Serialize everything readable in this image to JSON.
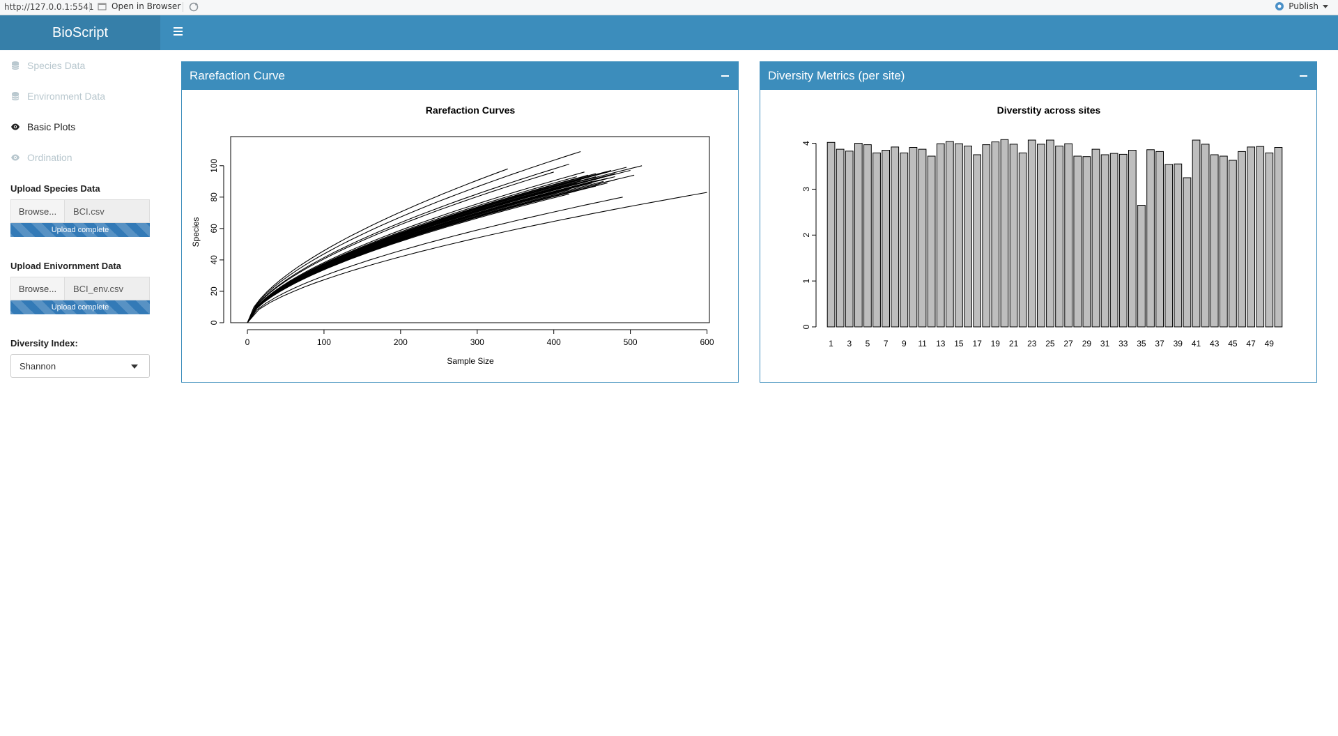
{
  "viewer": {
    "url": "http://127.0.0.1:5541",
    "open_in_browser": "Open in Browser",
    "publish": "Publish"
  },
  "app": {
    "title": "BioScript"
  },
  "sidebar": {
    "menu": [
      {
        "label": "Species Data",
        "icon": "database-icon",
        "active": false
      },
      {
        "label": "Environment Data",
        "icon": "database-icon",
        "active": false
      },
      {
        "label": "Basic Plots",
        "icon": "eye-icon",
        "active": true
      },
      {
        "label": "Ordination",
        "icon": "eye-icon",
        "active": false
      }
    ],
    "upload_species": {
      "label": "Upload Species Data",
      "button": "Browse...",
      "file": "BCI.csv",
      "progress_text": "Upload complete",
      "progress": 1.0
    },
    "upload_env": {
      "label": "Upload Enivornment Data",
      "button": "Browse...",
      "file": "BCI_env.csv",
      "progress_text": "Upload complete",
      "progress": 1.0
    },
    "diversity": {
      "label": "Diversity Index:",
      "selected": "Shannon"
    }
  },
  "boxes": {
    "rarefaction": {
      "title": "Rarefaction Curve",
      "collapse": "−"
    },
    "diversity": {
      "title": "Diversity Metrics (per site)",
      "collapse": "−"
    }
  },
  "chart_data": [
    {
      "type": "line",
      "title": "Rarefaction Curves",
      "xlabel": "Sample Size",
      "ylabel": "Species",
      "xlim": [
        0,
        625
      ],
      "ylim": [
        0,
        115
      ],
      "xticks": [
        0,
        100,
        200,
        300,
        400,
        500,
        600
      ],
      "yticks": [
        0,
        20,
        40,
        60,
        80,
        100
      ],
      "grid": false,
      "series_endpoints": [
        [
          448,
          93
        ],
        [
          435,
          85
        ],
        [
          430,
          84
        ],
        [
          420,
          82
        ],
        [
          460,
          95
        ],
        [
          475,
          94
        ],
        [
          390,
          80
        ],
        [
          430,
          87
        ],
        [
          410,
          88
        ],
        [
          450,
          89
        ],
        [
          460,
          92
        ],
        [
          480,
          91
        ],
        [
          500,
          97
        ],
        [
          440,
          96
        ],
        [
          425,
          90
        ],
        [
          470,
          89
        ],
        [
          455,
          93
        ],
        [
          435,
          91
        ],
        [
          515,
          100
        ],
        [
          505,
          94
        ],
        [
          430,
          92
        ],
        [
          480,
          95
        ],
        [
          415,
          87
        ],
        [
          445,
          86
        ],
        [
          460,
          88
        ],
        [
          435,
          109
        ],
        [
          340,
          98
        ],
        [
          490,
          80
        ],
        [
          600,
          83
        ],
        [
          470,
          96
        ],
        [
          420,
          101
        ],
        [
          400,
          96
        ],
        [
          440,
          90
        ],
        [
          455,
          87
        ],
        [
          470,
          92
        ],
        [
          430,
          89
        ],
        [
          410,
          84
        ],
        [
          460,
          91
        ],
        [
          445,
          94
        ],
        [
          425,
          86
        ],
        [
          480,
          93
        ],
        [
          450,
          90
        ],
        [
          495,
          99
        ],
        [
          435,
          88
        ],
        [
          465,
          90
        ],
        [
          440,
          92
        ],
        [
          420,
          85
        ],
        [
          455,
          95
        ],
        [
          430,
          93
        ],
        [
          475,
          97
        ]
      ]
    },
    {
      "type": "bar",
      "title": "Diverstity across sites",
      "categories": [
        "1",
        "2",
        "3",
        "4",
        "5",
        "6",
        "7",
        "8",
        "9",
        "10",
        "11",
        "12",
        "13",
        "14",
        "15",
        "16",
        "17",
        "18",
        "19",
        "20",
        "21",
        "22",
        "23",
        "24",
        "25",
        "26",
        "27",
        "28",
        "29",
        "30",
        "31",
        "32",
        "33",
        "34",
        "35",
        "36",
        "37",
        "38",
        "39",
        "40",
        "41",
        "42",
        "43",
        "44",
        "45",
        "46",
        "47",
        "48",
        "49",
        "50"
      ],
      "tick_labels_shown": [
        "1",
        "3",
        "5",
        "7",
        "9",
        "11",
        "13",
        "15",
        "17",
        "19",
        "21",
        "23",
        "25",
        "27",
        "29",
        "31",
        "33",
        "35",
        "37",
        "39",
        "41",
        "43",
        "45",
        "47",
        "49"
      ],
      "values": [
        4.02,
        3.87,
        3.83,
        4.0,
        3.97,
        3.79,
        3.85,
        3.92,
        3.79,
        3.91,
        3.87,
        3.72,
        3.99,
        4.04,
        3.99,
        3.94,
        3.75,
        3.97,
        4.03,
        4.08,
        3.98,
        3.79,
        4.07,
        3.98,
        4.07,
        3.94,
        3.99,
        3.72,
        3.71,
        3.87,
        3.75,
        3.78,
        3.76,
        3.85,
        2.65,
        3.86,
        3.82,
        3.54,
        3.55,
        3.25,
        4.07,
        3.98,
        3.75,
        3.72,
        3.63,
        3.82,
        3.92,
        3.93,
        3.79,
        3.91
      ],
      "ylim": [
        0,
        4.1
      ],
      "yticks": [
        0,
        1,
        2,
        3,
        4
      ],
      "bar_color": "#bebebe",
      "grid": false
    }
  ]
}
